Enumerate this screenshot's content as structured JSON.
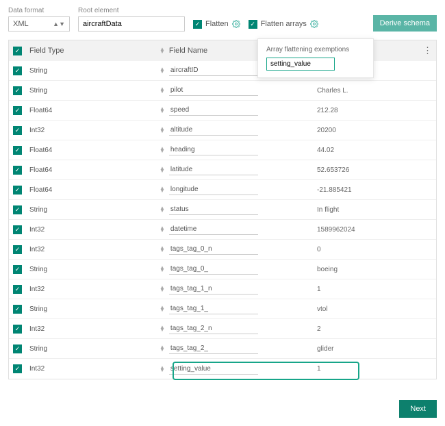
{
  "labels": {
    "dataFormat": "Data format",
    "rootElement": "Root element",
    "flatten": "Flatten",
    "flattenArrays": "Flatten arrays",
    "deriveSchema": "Derive schema",
    "fieldType": "Field Type",
    "fieldName": "Field Name",
    "next": "Next"
  },
  "values": {
    "dataFormat": "XML",
    "rootElement": "aircraftData"
  },
  "popover": {
    "title": "Array flattening exemptions",
    "value": "setting_value"
  },
  "rows": [
    {
      "type": "String",
      "name": "aircraftID",
      "value": ""
    },
    {
      "type": "String",
      "name": "pilot",
      "value": "Charles L."
    },
    {
      "type": "Float64",
      "name": "speed",
      "value": "212.28"
    },
    {
      "type": "Int32",
      "name": "altitude",
      "value": "20200"
    },
    {
      "type": "Float64",
      "name": "heading",
      "value": "44.02"
    },
    {
      "type": "Float64",
      "name": "latitude",
      "value": "52.653726"
    },
    {
      "type": "Float64",
      "name": "longitude",
      "value": "-21.885421"
    },
    {
      "type": "String",
      "name": "status",
      "value": "In flight"
    },
    {
      "type": "Int32",
      "name": "datetime",
      "value": "1589962024"
    },
    {
      "type": "Int32",
      "name": "tags_tag_0_n",
      "value": "0"
    },
    {
      "type": "String",
      "name": "tags_tag_0_",
      "value": "boeing"
    },
    {
      "type": "Int32",
      "name": "tags_tag_1_n",
      "value": "1"
    },
    {
      "type": "String",
      "name": "tags_tag_1_",
      "value": "vtol"
    },
    {
      "type": "Int32",
      "name": "tags_tag_2_n",
      "value": "2"
    },
    {
      "type": "String",
      "name": "tags_tag_2_",
      "value": "glider"
    },
    {
      "type": "Int32",
      "name": "setting_value",
      "value": "1"
    }
  ]
}
